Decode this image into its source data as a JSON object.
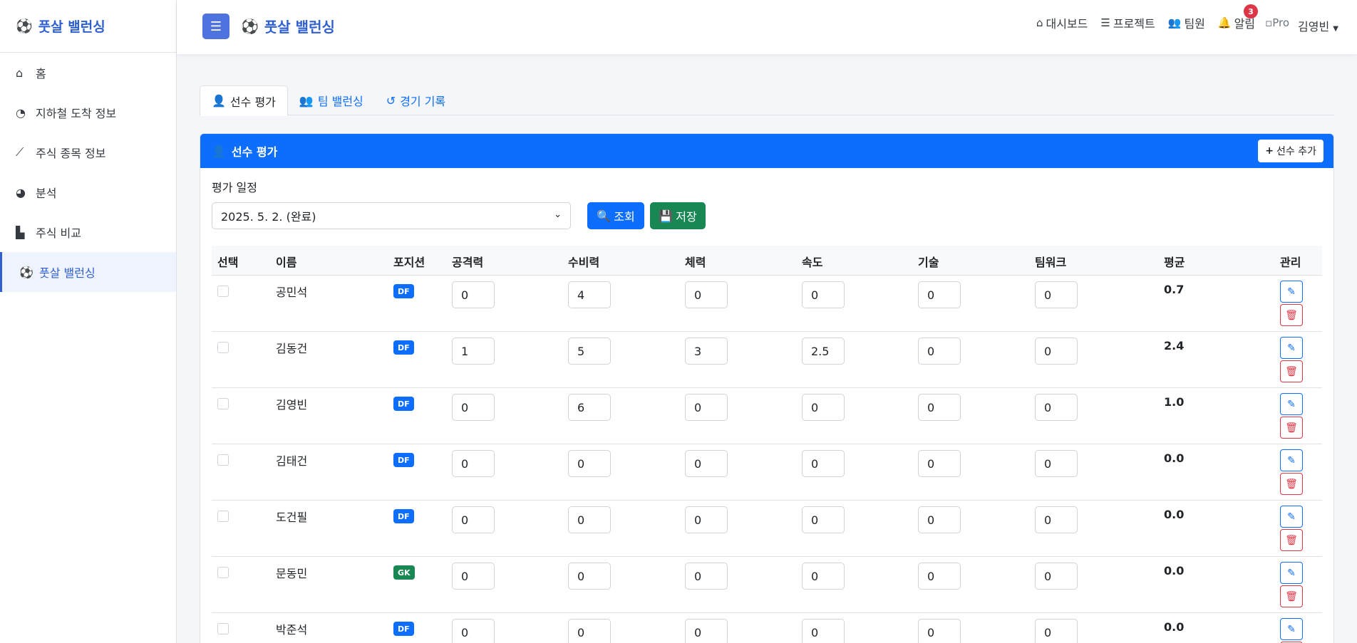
{
  "app": {
    "title": "풋살 밸런싱"
  },
  "sidebar": {
    "brand": "풋살 밸런싱",
    "items": [
      {
        "label": "홈",
        "icon": "home-icon"
      },
      {
        "label": "지하철 도착 정보",
        "icon": "gauge-icon"
      },
      {
        "label": "주식 종목 정보",
        "icon": "line-chart-icon"
      },
      {
        "label": "분석",
        "icon": "pie-chart-icon"
      },
      {
        "label": "주식 비교",
        "icon": "bar-chart-icon"
      },
      {
        "label": "풋살 밸런싱",
        "icon": "soccer-ball-icon",
        "active": true
      }
    ]
  },
  "topbar": {
    "title": "풋살 밸런싱",
    "links": {
      "dashboard": "대시보드",
      "projects": "프로젝트",
      "team": "팀원",
      "alarm": "알림"
    },
    "alarm_count": "3",
    "avatar_alt": "Pro",
    "user": "김영빈"
  },
  "tabs": [
    {
      "label": "선수 평가",
      "active": true
    },
    {
      "label": "팀 밸런싱"
    },
    {
      "label": "경기 기록"
    }
  ],
  "card": {
    "title": "선수 평가",
    "add_label": "선수 추가",
    "schedule_label": "평가 일정",
    "schedule_value": "2025. 5. 2. (완료)",
    "search_label": "조회",
    "save_label": "저장"
  },
  "table": {
    "headers": {
      "select": "선택",
      "name": "이름",
      "position": "포지션",
      "attack": "공격력",
      "defense": "수비력",
      "stamina": "체력",
      "speed": "속도",
      "skill": "기술",
      "teamwork": "팀워크",
      "avg": "평균",
      "manage": "관리"
    },
    "rows": [
      {
        "name": "공민석",
        "position": "DF",
        "attack": "0",
        "defense": "4",
        "stamina": "0",
        "speed": "0",
        "skill": "0",
        "teamwork": "0",
        "avg": "0.7"
      },
      {
        "name": "김동건",
        "position": "DF",
        "attack": "1",
        "defense": "5",
        "stamina": "3",
        "speed": "2.5",
        "skill": "0",
        "teamwork": "0",
        "avg": "2.4"
      },
      {
        "name": "김영빈",
        "position": "DF",
        "attack": "0",
        "defense": "6",
        "stamina": "0",
        "speed": "0",
        "skill": "0",
        "teamwork": "0",
        "avg": "1.0"
      },
      {
        "name": "김태건",
        "position": "DF",
        "attack": "0",
        "defense": "0",
        "stamina": "0",
        "speed": "0",
        "skill": "0",
        "teamwork": "0",
        "avg": "0.0"
      },
      {
        "name": "도건필",
        "position": "DF",
        "attack": "0",
        "defense": "0",
        "stamina": "0",
        "speed": "0",
        "skill": "0",
        "teamwork": "0",
        "avg": "0.0"
      },
      {
        "name": "문동민",
        "position": "GK",
        "attack": "0",
        "defense": "0",
        "stamina": "0",
        "speed": "0",
        "skill": "0",
        "teamwork": "0",
        "avg": "0.0"
      },
      {
        "name": "박준석",
        "position": "DF",
        "attack": "0",
        "defense": "0",
        "stamina": "0",
        "speed": "0",
        "skill": "0",
        "teamwork": "0",
        "avg": "0.0"
      }
    ]
  },
  "colors": {
    "primary": "#0d6efd",
    "success": "#198754",
    "danger": "#dc3545",
    "brand": "#2f5fd0"
  }
}
